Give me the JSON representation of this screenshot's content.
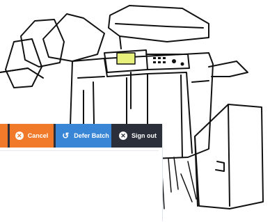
{
  "toolbar": {
    "cancel_label": "Cancel",
    "defer_label": "Defer Batch",
    "signout_label": "Sign out"
  },
  "icons": {
    "cancel": "close-circle-icon",
    "defer": "defer-clock-icon",
    "signout": "close-circle-icon"
  },
  "colors": {
    "accent_orange": "#f07a2a",
    "accent_blue": "#3a86d6",
    "toolbar_dark": "#2a2f39"
  }
}
